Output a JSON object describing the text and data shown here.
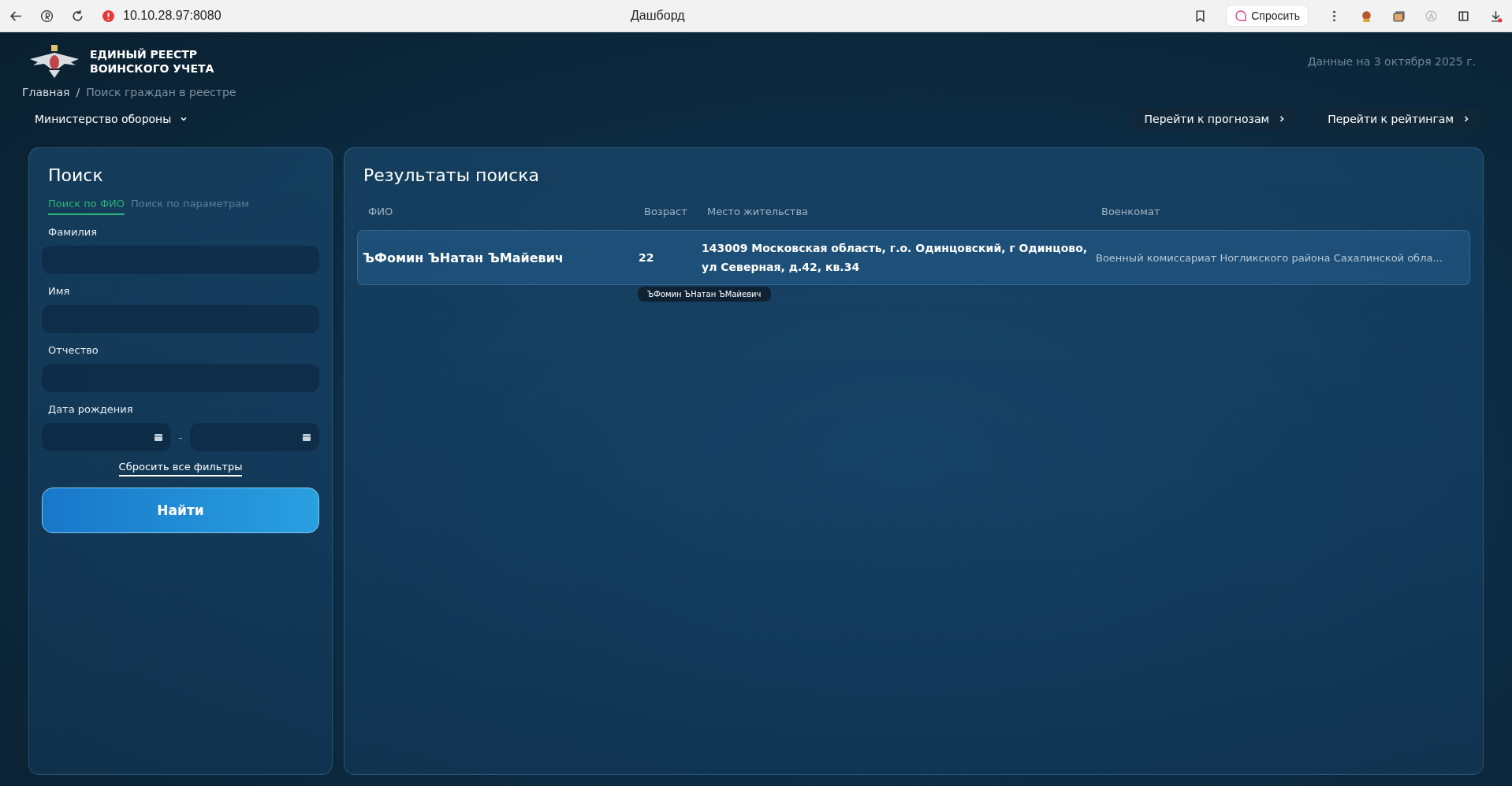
{
  "browser": {
    "address": "10.10.28.97:8080",
    "title": "Дашборд",
    "ask_button": "Спросить"
  },
  "header": {
    "title_lines": [
      "ЕДИНЫЙ РЕЕСТР",
      "ВОИНСКОГО УЧЕТА"
    ],
    "data_date": "Данные на 3 октября 2025 г."
  },
  "breadcrumbs": {
    "separator": "/",
    "items": [
      "Главная",
      "Поиск граждан в реестре"
    ]
  },
  "department_select": "Министерство обороны",
  "nav_links": [
    "Перейти к прогнозам",
    "Перейти к рейтингам"
  ],
  "search_panel": {
    "title": "Поиск",
    "tabs": [
      {
        "label": "Поиск по ФИО",
        "selected": true
      },
      {
        "label": "Поиск по параметрам",
        "selected": false
      }
    ],
    "fields": [
      {
        "label": "Фамилия",
        "kind": "text"
      },
      {
        "label": "Имя",
        "kind": "text"
      },
      {
        "label": "Отчество",
        "kind": "text"
      },
      {
        "label": "Дата рождения",
        "kind": "date_range"
      }
    ],
    "date_separator": "-",
    "reset_link": "Сбросить все фильтры",
    "submit_button": "Найти"
  },
  "results": {
    "title": "Результаты поиска",
    "columns": [
      "ФИО",
      "Возраст",
      "Место жительства",
      "Военкомат"
    ],
    "rows": [
      {
        "cells": [
          "ЪФомин ЪНатан ЪМайевич",
          "22",
          "143009 Московская область, г.о. Одинцовский, г Одинцово, ул Северная, д.42, кв.34",
          "Военный комиссариат Ногликского района Сахалинской обла..."
        ],
        "tooltip": "ЪФомин ЪНатан ЪМайевич"
      }
    ]
  }
}
